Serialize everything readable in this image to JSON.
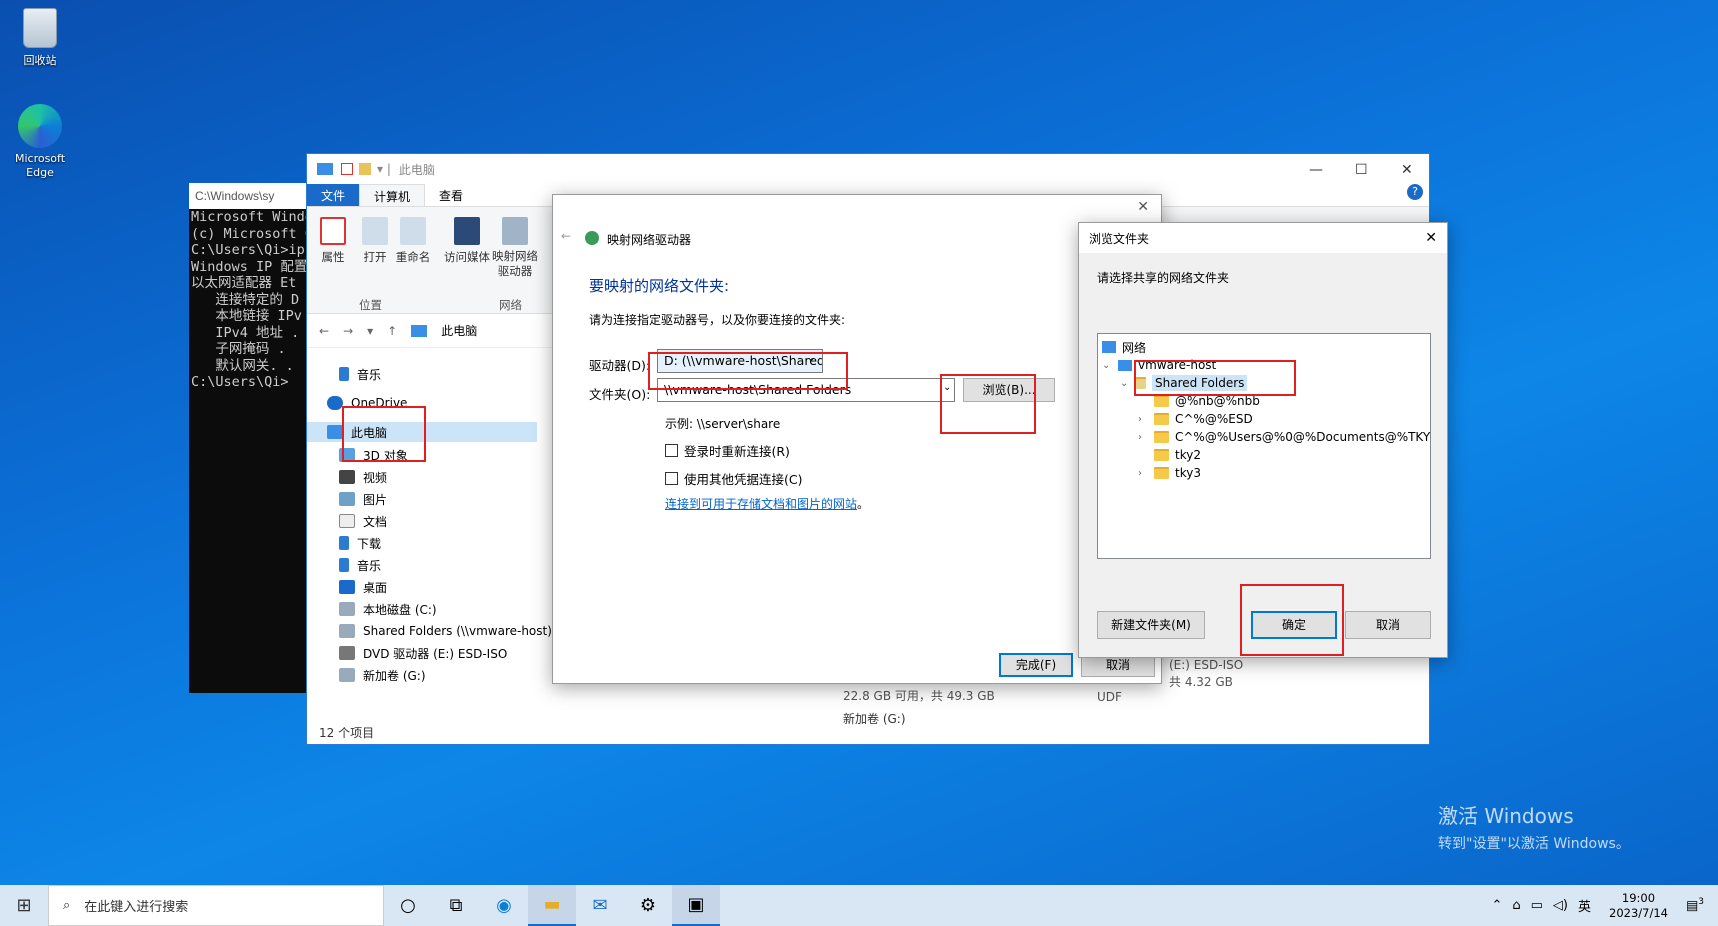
{
  "desktop": {
    "recycle_bin": "回收站",
    "edge": "Microsoft Edge"
  },
  "cmd": {
    "title": "C:\\Windows\\sy",
    "lines": [
      "Microsoft Windo",
      "(c) Microsoft C",
      "",
      "C:\\Users\\Qi>ipc",
      "",
      "Windows IP 配置",
      "",
      "",
      "以太网适配器 Et",
      "",
      "   连接特定的 D",
      "   本地链接 IPv",
      "   IPv4 地址 .",
      "   子网掩码 .",
      "   默认网关. .",
      "",
      "C:\\Users\\Qi>"
    ]
  },
  "explorer": {
    "title": "此电脑",
    "tabs": {
      "file": "文件",
      "computer": "计算机",
      "view": "查看"
    },
    "ribbon": {
      "properties": "属性",
      "open": "打开",
      "rename": "重命名",
      "access_media": "访问媒体",
      "map_drive": "映射网络驱动器",
      "location_group": "位置",
      "network_group": "网络"
    },
    "address": "此电脑",
    "nav": {
      "music_top": "音乐",
      "onedrive": "OneDrive",
      "this_pc": "此电脑",
      "objects3d": "3D 对象",
      "videos": "视频",
      "pictures": "图片",
      "documents": "文档",
      "downloads": "下载",
      "music": "音乐",
      "desktop": "桌面",
      "local_disk": "本地磁盘 (C:)",
      "shared": "Shared Folders (\\\\vmware-host) (",
      "dvd": "DVD 驱动器 (E:) ESD-ISO",
      "new_vol": "新加卷 (G:)"
    },
    "content": {
      "free": "22.8 GB 可用，共 49.3 GB",
      "udf": "UDF",
      "total": "共 4.32 GB",
      "newvol": "新加卷 (G:)",
      "esd": "(E:) ESD-ISO"
    },
    "status": "12 个项目"
  },
  "map": {
    "title": "映射网络驱动器",
    "heading": "要映射的网络文件夹:",
    "instruction": "请为连接指定驱动器号，以及你要连接的文件夹:",
    "drive_label": "驱动器(D):",
    "drive_value": "D: (\\\\vmware-host\\Shared",
    "folder_label": "文件夹(O):",
    "folder_value": "\\\\vmware-host\\Shared Folders",
    "browse": "浏览(B)...",
    "example": "示例: \\\\server\\share",
    "reconnect": "登录时重新连接(R)",
    "other_creds": "使用其他凭据连接(C)",
    "link": "连接到可用于存储文档和图片的网站",
    "link_end": "。",
    "finish": "完成(F)",
    "cancel": "取消"
  },
  "browse": {
    "title": "浏览文件夹",
    "prompt": "请选择共享的网络文件夹",
    "tree": {
      "network": "网络",
      "host": "vmware-host",
      "shared": "Shared Folders",
      "f1": "@%nb@%nbb",
      "f2": "C^%@%ESD",
      "f3": "C^%@%Users@%0@%Documents@%TKY",
      "f4": "tky2",
      "f5": "tky3"
    },
    "new_folder": "新建文件夹(M)",
    "ok": "确定",
    "cancel": "取消"
  },
  "taskbar": {
    "search": "在此键入进行搜索",
    "time": "19:00",
    "date": "2023/7/14",
    "lang": "英",
    "notif": "3"
  },
  "watermark": {
    "line1": "激活 Windows",
    "line2": "转到\"设置\"以激活 Windows。"
  }
}
